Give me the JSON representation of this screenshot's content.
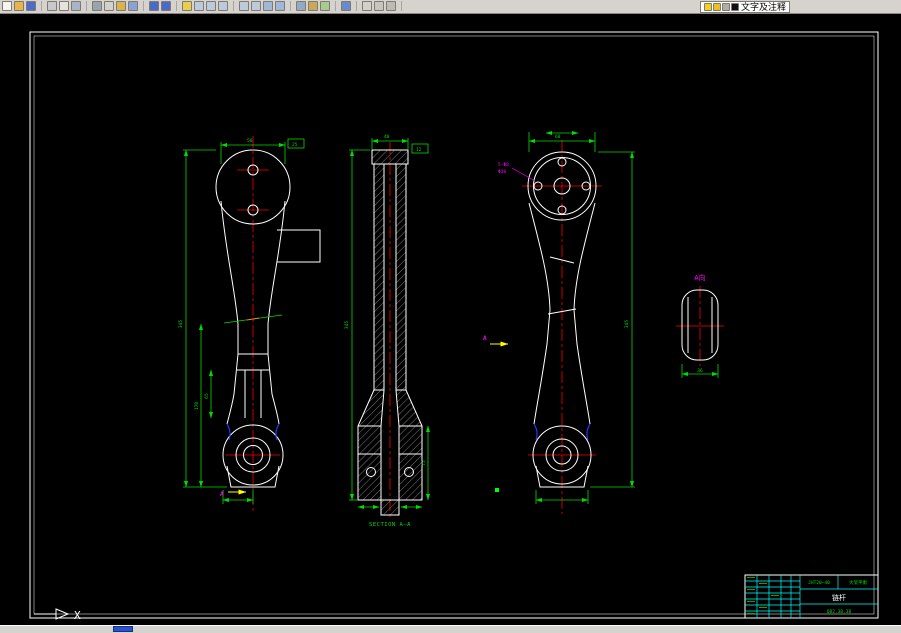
{
  "toolbar": {
    "layer_label": "文字及注释",
    "icon_groups": [
      [
        {
          "name": "new-file",
          "color": "#f6f6ee"
        },
        {
          "name": "open-file",
          "color": "#e9b44a"
        },
        {
          "name": "save-file",
          "color": "#4f6bc9"
        }
      ],
      [
        {
          "name": "plot",
          "color": "#c9c9c9"
        },
        {
          "name": "plot-preview",
          "color": "#e4e4dc"
        },
        {
          "name": "publish",
          "color": "#aab4c6"
        }
      ],
      [
        {
          "name": "cut",
          "color": "#9aa4ae"
        },
        {
          "name": "copy",
          "color": "#d2d2ca"
        },
        {
          "name": "paste",
          "color": "#d9b351"
        },
        {
          "name": "match-properties",
          "color": "#8ba3d2"
        }
      ],
      [
        {
          "name": "undo",
          "color": "#4a69c9"
        },
        {
          "name": "redo",
          "color": "#4a69c9"
        }
      ],
      [
        {
          "name": "pan",
          "color": "#e7cf49"
        },
        {
          "name": "zoom-realtime",
          "color": "#bccadb"
        },
        {
          "name": "zoom-window",
          "color": "#bccadb"
        },
        {
          "name": "zoom-previous",
          "color": "#bccadb"
        }
      ],
      [
        {
          "name": "zoom-in",
          "color": "#bccadb"
        },
        {
          "name": "zoom-out",
          "color": "#bccadb"
        },
        {
          "name": "zoom-extents",
          "color": "#9fb8d8"
        },
        {
          "name": "zoom-all",
          "color": "#9fb8d8"
        }
      ],
      [
        {
          "name": "properties",
          "color": "#93a9c4"
        },
        {
          "name": "design-center",
          "color": "#c9a957"
        },
        {
          "name": "tool-palettes",
          "color": "#a9c993"
        }
      ],
      [
        {
          "name": "help",
          "color": "#6a8ace"
        }
      ],
      [
        {
          "name": "layer-properties-manager",
          "color": "#d2d2ca"
        },
        {
          "name": "make-objects-layer-current",
          "color": "#c6c6be"
        },
        {
          "name": "layer-previous",
          "color": "#bcbcb4"
        }
      ]
    ],
    "layer_state_icons": [
      {
        "name": "lightbulb",
        "color": "#f0d020"
      },
      {
        "name": "sun",
        "color": "#f0c020"
      },
      {
        "name": "lock",
        "color": "#b0afa6"
      },
      {
        "name": "layer-color-swatch",
        "color": "#111111"
      }
    ]
  },
  "canvas": {
    "labels": {
      "section": "SECTION A—A",
      "a_view": "A向",
      "section_marker": "A"
    },
    "dims": {
      "d_head": "50",
      "d_box1": "25",
      "d_total": "345",
      "d_shank": "170",
      "d_step": "65",
      "d_sec_top": "40",
      "d_box2": "12",
      "d_sec_boss": "75",
      "d_head3": "68",
      "d_a": "36"
    },
    "annotations": {
      "bolt_note": "5-Φ8",
      "pcd_note": "Φ38"
    },
    "ucs": {
      "x_label": "X"
    },
    "title_block": {
      "drawing_no": "JHT20—40",
      "project": "大架平衡",
      "part_name": "链杆",
      "code": "QB2.3B.3B"
    }
  },
  "colors": {
    "line": "#ffffff",
    "dim": "#00dd00",
    "center": "#ff0000",
    "table": "#00ffff",
    "annot": "#ff00ff",
    "marker": "#ffff00",
    "fillet": "#3535ff"
  }
}
